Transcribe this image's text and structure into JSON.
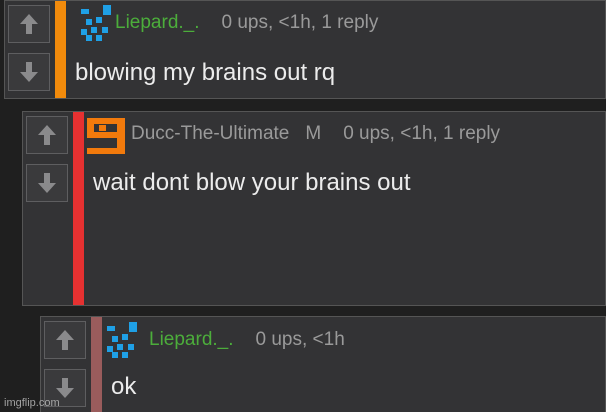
{
  "colors": {
    "background": "#1f1f1f",
    "comment_bg": "#333335",
    "username_green": "#4cad3b",
    "muted_text": "#9a9a9a",
    "body_text": "#ececec",
    "bar_orange": "#f28b0c",
    "bar_red": "#e63131",
    "bar_muted": "#9a5c5c",
    "avatar_blue": "#1fa0e6",
    "avatar_orange": "#f27a0c"
  },
  "comments": [
    {
      "username": "Liepard._.",
      "stats": "0 ups, <1h, 1 reply",
      "text": "blowing my brains out rq",
      "upvote_icon": "arrow-up-icon",
      "downvote_icon": "arrow-down-icon",
      "avatar_icon": "pixel-avatar-icon"
    },
    {
      "username": "Ducc-The-Ultimate",
      "badge": "M",
      "stats": "0 ups, <1h, 1 reply",
      "text": "wait dont blow your brains out",
      "upvote_icon": "arrow-up-icon",
      "downvote_icon": "arrow-down-icon",
      "avatar_icon": "pixel-avatar-icon"
    },
    {
      "username": "Liepard._.",
      "stats": "0 ups, <1h",
      "text": "ok",
      "upvote_icon": "arrow-up-icon",
      "downvote_icon": "arrow-down-icon",
      "avatar_icon": "pixel-avatar-icon"
    }
  ],
  "watermark": "imgflip.com"
}
